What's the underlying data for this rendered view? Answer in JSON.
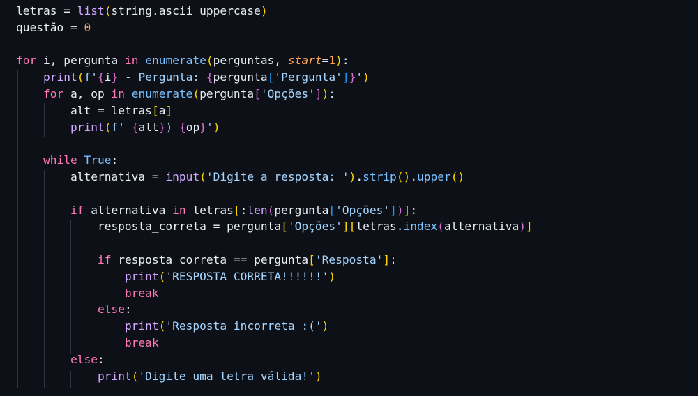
{
  "editor": {
    "theme_colors": {
      "background": "#0d1117",
      "keyword": "#ff7ab2",
      "builtin": "#d2a8ff",
      "string": "#a5d6ff",
      "number": "#ffa657",
      "bracket_1": "#ffd700",
      "bracket_2": "#da70d6",
      "bracket_3": "#179fff"
    },
    "lines": [
      {
        "tokens": [
          [
            "pl",
            "letras "
          ],
          [
            "op",
            "= "
          ],
          [
            "fn",
            "list"
          ],
          [
            "b1",
            "("
          ],
          [
            "pl",
            "string.ascii_uppercase"
          ],
          [
            "b1",
            ")"
          ]
        ]
      },
      {
        "tokens": [
          [
            "pl",
            "questão "
          ],
          [
            "op",
            "= "
          ],
          [
            "num",
            "0"
          ]
        ]
      },
      {
        "tokens": []
      },
      {
        "tokens": [
          [
            "kw",
            "for"
          ],
          [
            "pl",
            " i, pergunta "
          ],
          [
            "kw",
            "in"
          ],
          [
            "pl",
            " "
          ],
          [
            "call",
            "enumerate"
          ],
          [
            "b1",
            "("
          ],
          [
            "pl",
            "perguntas, "
          ],
          [
            "param",
            "start"
          ],
          [
            "op",
            "="
          ],
          [
            "num",
            "1"
          ],
          [
            "b1",
            ")"
          ],
          [
            "pl",
            ":"
          ]
        ]
      },
      {
        "tokens": [
          [
            "pl",
            "    "
          ],
          [
            "fn",
            "print"
          ],
          [
            "b1",
            "("
          ],
          [
            "str",
            "f'"
          ],
          [
            "b2",
            "{"
          ],
          [
            "pl",
            "i"
          ],
          [
            "b2",
            "}"
          ],
          [
            "str",
            " - Pergunta: "
          ],
          [
            "b2",
            "{"
          ],
          [
            "pl",
            "pergunta"
          ],
          [
            "b3",
            "["
          ],
          [
            "str",
            "'Pergunta'"
          ],
          [
            "b3",
            "]"
          ],
          [
            "b2",
            "}"
          ],
          [
            "str",
            "'"
          ],
          [
            "b1",
            ")"
          ]
        ]
      },
      {
        "tokens": [
          [
            "pl",
            "    "
          ],
          [
            "kw",
            "for"
          ],
          [
            "pl",
            " a, op "
          ],
          [
            "kw",
            "in"
          ],
          [
            "pl",
            " "
          ],
          [
            "call",
            "enumerate"
          ],
          [
            "b1",
            "("
          ],
          [
            "pl",
            "pergunta"
          ],
          [
            "b2",
            "["
          ],
          [
            "str",
            "'Opções'"
          ],
          [
            "b2",
            "]"
          ],
          [
            "b1",
            ")"
          ],
          [
            "pl",
            ":"
          ]
        ]
      },
      {
        "tokens": [
          [
            "pl",
            "        alt "
          ],
          [
            "op",
            "= "
          ],
          [
            "pl",
            "letras"
          ],
          [
            "b1",
            "["
          ],
          [
            "pl",
            "a"
          ],
          [
            "b1",
            "]"
          ]
        ]
      },
      {
        "tokens": [
          [
            "pl",
            "        "
          ],
          [
            "fn",
            "print"
          ],
          [
            "b1",
            "("
          ],
          [
            "str",
            "f' "
          ],
          [
            "b2",
            "{"
          ],
          [
            "pl",
            "alt"
          ],
          [
            "b2",
            "}"
          ],
          [
            "str",
            ") "
          ],
          [
            "b2",
            "{"
          ],
          [
            "pl",
            "op"
          ],
          [
            "b2",
            "}"
          ],
          [
            "str",
            "'"
          ],
          [
            "b1",
            ")"
          ]
        ]
      },
      {
        "tokens": []
      },
      {
        "tokens": [
          [
            "pl",
            "    "
          ],
          [
            "kw",
            "while"
          ],
          [
            "pl",
            " "
          ],
          [
            "cons",
            "True"
          ],
          [
            "pl",
            ":"
          ]
        ]
      },
      {
        "tokens": [
          [
            "pl",
            "        alternativa "
          ],
          [
            "op",
            "= "
          ],
          [
            "fn",
            "input"
          ],
          [
            "b1",
            "("
          ],
          [
            "str",
            "'Digite a resposta: '"
          ],
          [
            "b1",
            ")"
          ],
          [
            "pl",
            "."
          ],
          [
            "call",
            "strip"
          ],
          [
            "b1",
            "()"
          ],
          [
            "pl",
            "."
          ],
          [
            "call",
            "upper"
          ],
          [
            "b1",
            "()"
          ]
        ]
      },
      {
        "tokens": []
      },
      {
        "tokens": [
          [
            "pl",
            "        "
          ],
          [
            "kw",
            "if"
          ],
          [
            "pl",
            " alternativa "
          ],
          [
            "kw",
            "in"
          ],
          [
            "pl",
            " letras"
          ],
          [
            "b1",
            "["
          ],
          [
            "pl",
            ":"
          ],
          [
            "fn",
            "len"
          ],
          [
            "b2",
            "("
          ],
          [
            "pl",
            "pergunta"
          ],
          [
            "b3",
            "["
          ],
          [
            "str",
            "'Opções'"
          ],
          [
            "b3",
            "]"
          ],
          [
            "b2",
            ")"
          ],
          [
            "b1",
            "]"
          ],
          [
            "pl",
            ":"
          ]
        ]
      },
      {
        "tokens": [
          [
            "pl",
            "            resposta_correta "
          ],
          [
            "op",
            "= "
          ],
          [
            "pl",
            "pergunta"
          ],
          [
            "b1",
            "["
          ],
          [
            "str",
            "'Opções'"
          ],
          [
            "b1",
            "]"
          ],
          [
            "b1",
            "["
          ],
          [
            "pl",
            "letras."
          ],
          [
            "call",
            "index"
          ],
          [
            "b2",
            "("
          ],
          [
            "pl",
            "alternativa"
          ],
          [
            "b2",
            ")"
          ],
          [
            "b1",
            "]"
          ]
        ]
      },
      {
        "tokens": []
      },
      {
        "tokens": [
          [
            "pl",
            "            "
          ],
          [
            "kw",
            "if"
          ],
          [
            "pl",
            " resposta_correta "
          ],
          [
            "op",
            "== "
          ],
          [
            "pl",
            "pergunta"
          ],
          [
            "b1",
            "["
          ],
          [
            "str",
            "'Resposta'"
          ],
          [
            "b1",
            "]"
          ],
          [
            "pl",
            ":"
          ]
        ]
      },
      {
        "tokens": [
          [
            "pl",
            "                "
          ],
          [
            "fn",
            "print"
          ],
          [
            "b1",
            "("
          ],
          [
            "str",
            "'RESPOSTA CORRETA!!!!!!'"
          ],
          [
            "b1",
            ")"
          ]
        ]
      },
      {
        "tokens": [
          [
            "pl",
            "                "
          ],
          [
            "kw",
            "break"
          ]
        ]
      },
      {
        "tokens": [
          [
            "pl",
            "            "
          ],
          [
            "kw",
            "else"
          ],
          [
            "pl",
            ":"
          ]
        ]
      },
      {
        "tokens": [
          [
            "pl",
            "                "
          ],
          [
            "fn",
            "print"
          ],
          [
            "b1",
            "("
          ],
          [
            "str",
            "'Resposta incorreta :('"
          ],
          [
            "b1",
            ")"
          ]
        ]
      },
      {
        "tokens": [
          [
            "pl",
            "                "
          ],
          [
            "kw",
            "break"
          ]
        ]
      },
      {
        "tokens": [
          [
            "pl",
            "        "
          ],
          [
            "kw",
            "else"
          ],
          [
            "pl",
            ":"
          ]
        ]
      },
      {
        "tokens": [
          [
            "pl",
            "            "
          ],
          [
            "fn",
            "print"
          ],
          [
            "b1",
            "("
          ],
          [
            "str",
            "'Digite uma letra válida!'"
          ],
          [
            "b1",
            ")"
          ]
        ]
      }
    ]
  }
}
